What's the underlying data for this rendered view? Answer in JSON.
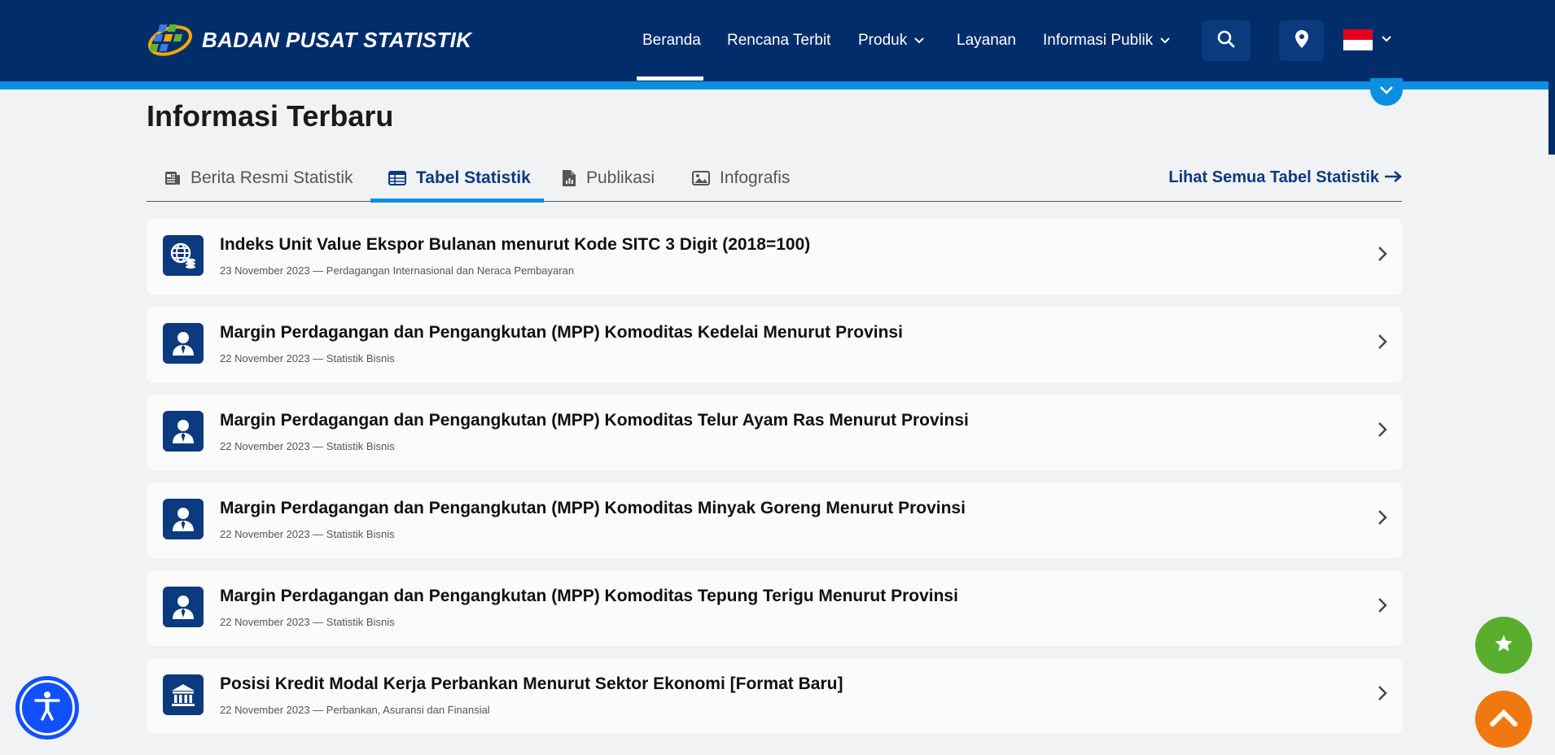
{
  "header": {
    "brand": "BADAN PUSAT STATISTIK",
    "nav": [
      {
        "label": "Beranda",
        "active": true
      },
      {
        "label": "Rencana Terbit"
      },
      {
        "label": "Produk",
        "dropdown": true
      },
      {
        "label": "Layanan"
      },
      {
        "label": "Informasi Publik",
        "dropdown": true
      }
    ],
    "icons": {
      "search": "search-icon",
      "location": "map-pin-icon",
      "language": "indonesia-flag-icon"
    }
  },
  "section": {
    "title": "Informasi Terbaru",
    "tabs": [
      {
        "label": "Berita Resmi Statistik",
        "icon": "news-icon"
      },
      {
        "label": "Tabel Statistik",
        "icon": "table-icon",
        "active": true
      },
      {
        "label": "Publikasi",
        "icon": "document-chart-icon"
      },
      {
        "label": "Infografis",
        "icon": "image-icon"
      }
    ],
    "see_all": "Lihat Semua Tabel Statistik"
  },
  "items": [
    {
      "title": "Indeks Unit Value Ekspor Bulanan menurut Kode SITC 3 Digit (2018=100)",
      "meta": "23 November 2023 — Perdagangan Internasional dan Neraca Pembayaran",
      "icon": "globe-coins-icon"
    },
    {
      "title": "Margin Perdagangan dan Pengangkutan (MPP) Komoditas Kedelai Menurut Provinsi",
      "meta": "22 November 2023 — Statistik Bisnis",
      "icon": "businessman-icon"
    },
    {
      "title": "Margin Perdagangan dan Pengangkutan (MPP) Komoditas Telur Ayam Ras Menurut Provinsi",
      "meta": "22 November 2023 — Statistik Bisnis",
      "icon": "businessman-icon"
    },
    {
      "title": "Margin Perdagangan dan Pengangkutan (MPP) Komoditas Minyak Goreng Menurut Provinsi",
      "meta": "22 November 2023 — Statistik Bisnis",
      "icon": "businessman-icon"
    },
    {
      "title": "Margin Perdagangan dan Pengangkutan (MPP) Komoditas Tepung Terigu Menurut Provinsi",
      "meta": "22 November 2023 — Statistik Bisnis",
      "icon": "businessman-icon"
    },
    {
      "title": "Posisi Kredit Modal Kerja Perbankan Menurut Sektor Ekonomi [Format Baru]",
      "meta": "22 November 2023 — Perbankan, Asuransi dan Finansial",
      "icon": "bank-icon"
    }
  ],
  "colors": {
    "header_bg": "#012d6b",
    "accent": "#0b8fe0",
    "brand_blue": "#0b3a7e",
    "fab_star": "#5aae2e",
    "fab_top": "#f0780f",
    "accessibility": "#1050ff"
  }
}
